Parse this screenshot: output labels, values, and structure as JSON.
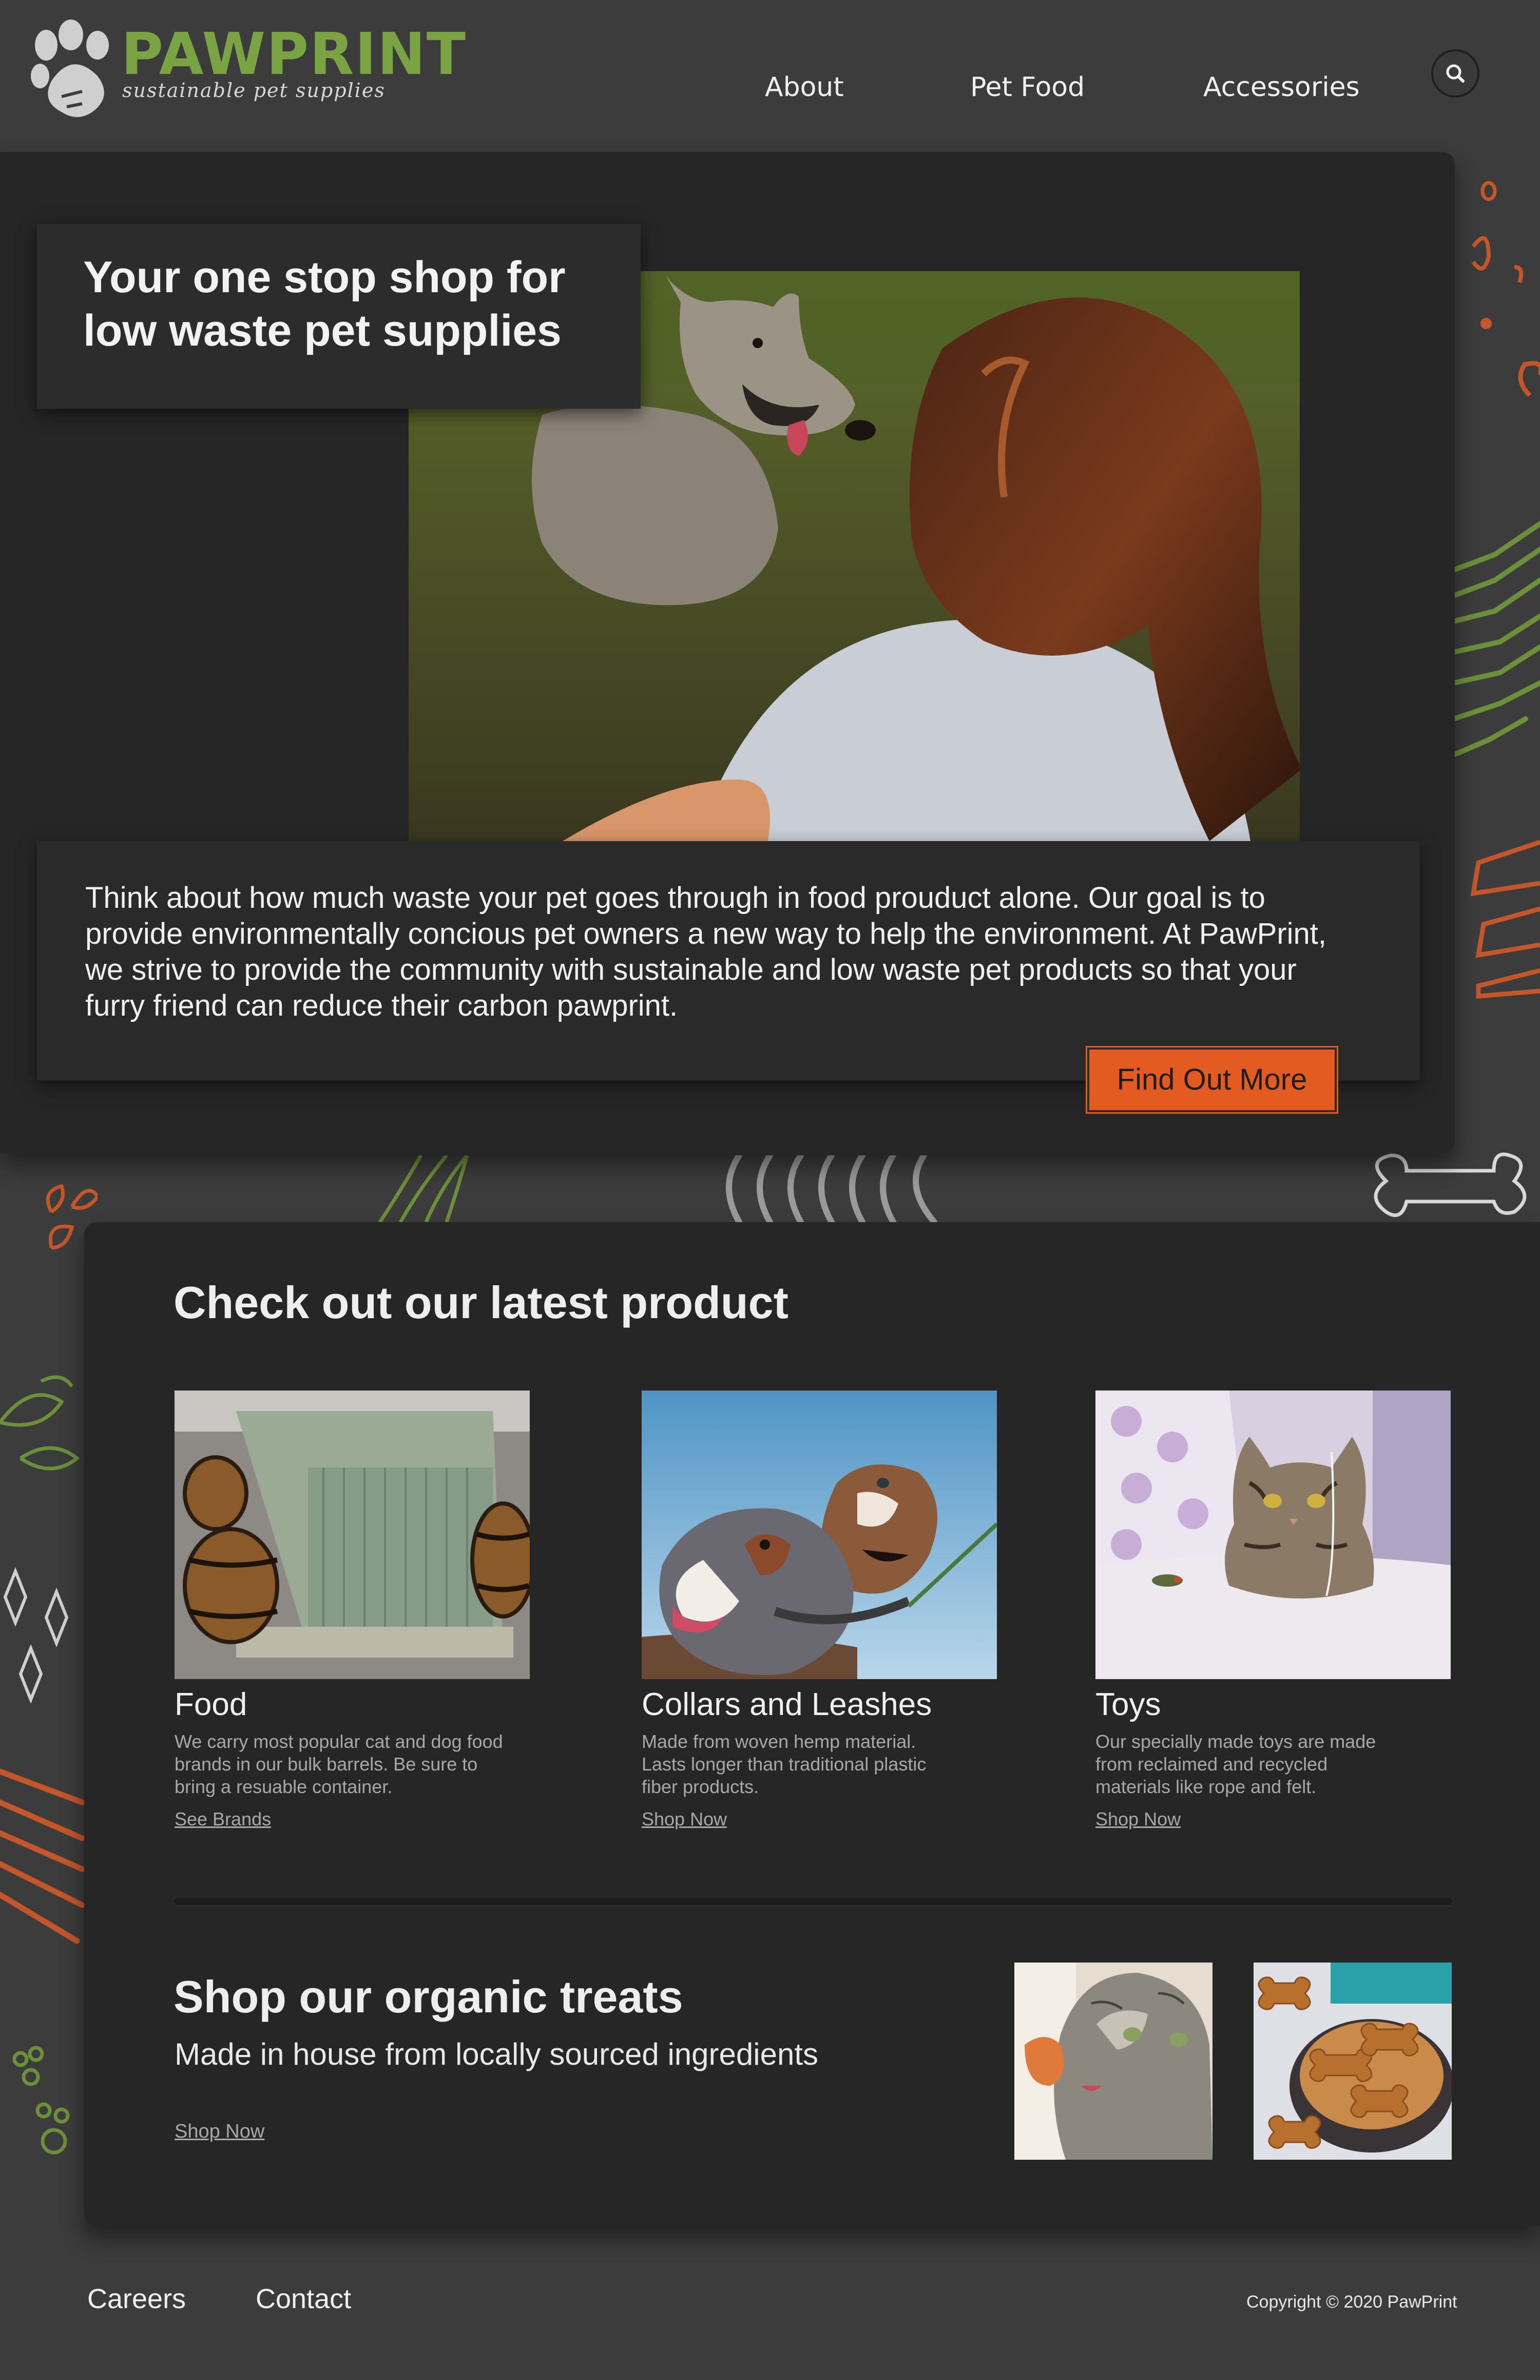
{
  "brand": {
    "name": "PAWPRINT",
    "tagline": "sustainable pet supplies",
    "colors": {
      "green": "#7aa444",
      "orange": "#e35b20",
      "background": "#3c3c3c",
      "panel": "#262626"
    }
  },
  "nav": {
    "items": [
      {
        "label": "About"
      },
      {
        "label": "Pet Food"
      },
      {
        "label": "Accessories"
      }
    ],
    "search_icon": "search-icon"
  },
  "hero": {
    "title": "Your one stop shop for low waste pet supplies",
    "body": "Think about how much waste your pet goes through in food prouduct alone. Our goal is to provide environmentally concious pet owners a new way to help the environment. At PawPrint, we strive to provide the community with sustainable and low waste pet products so that your furry friend can reduce their carbon pawprint.",
    "cta_label": "Find Out More",
    "image_subject": "woman-with-dog-photo"
  },
  "latest": {
    "title": "Check out our latest product",
    "cards": [
      {
        "title": "Food",
        "description": "We carry most popular cat and dog food brands in our bulk barrels. Be sure to bring a resuable container.",
        "link": "See Brands",
        "image": "bulk-barrels-photo"
      },
      {
        "title": "Collars and Leashes",
        "description": "Made from woven hemp material. Lasts longer than traditional plastic fiber products.",
        "link": "Shop Now",
        "image": "two-dogs-leash-photo"
      },
      {
        "title": "Toys",
        "description": "Our specially made toys are made from reclaimed and recycled materials like rope and felt.",
        "link": "Shop Now",
        "image": "cat-with-toy-photo"
      }
    ]
  },
  "treats": {
    "title": "Shop our organic treats",
    "subtitle": "Made in house from locally sourced ingredients",
    "link": "Shop Now",
    "images": [
      "cat-eating-treat-photo",
      "dog-biscuits-bowl-photo"
    ]
  },
  "footer": {
    "links": [
      {
        "label": "Careers"
      },
      {
        "label": "Contact"
      }
    ],
    "copyright": "Copyright © 2020 PawPrint"
  }
}
